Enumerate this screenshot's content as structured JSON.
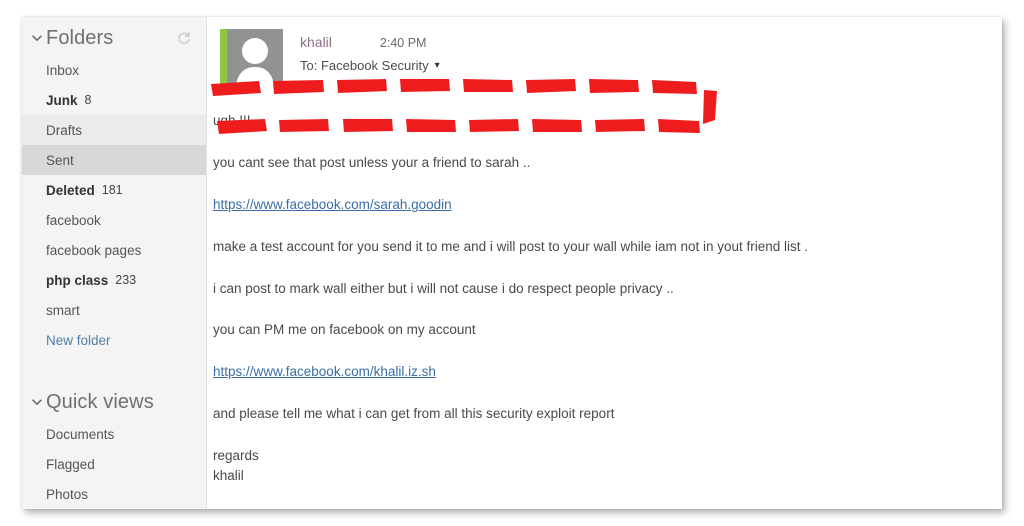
{
  "sidebar": {
    "folders_section": {
      "title": "Folders",
      "chevron_icon": "chevron-down-icon",
      "refresh_icon": "refresh-icon"
    },
    "folders": [
      {
        "label": "Inbox",
        "count": "",
        "style": "normal",
        "state": ""
      },
      {
        "label": "Junk",
        "count": "8",
        "style": "bold",
        "state": ""
      },
      {
        "label": "Drafts",
        "count": "",
        "style": "normal",
        "state": "hover"
      },
      {
        "label": "Sent",
        "count": "",
        "style": "normal",
        "state": "selected"
      },
      {
        "label": "Deleted",
        "count": "181",
        "style": "bold",
        "state": ""
      },
      {
        "label": "facebook",
        "count": "",
        "style": "normal",
        "state": ""
      },
      {
        "label": "facebook pages",
        "count": "",
        "style": "normal",
        "state": ""
      },
      {
        "label": "php class",
        "count": "233",
        "style": "bold",
        "state": ""
      },
      {
        "label": "smart",
        "count": "",
        "style": "normal",
        "state": ""
      },
      {
        "label": "New folder",
        "count": "",
        "style": "link",
        "state": ""
      }
    ],
    "quickviews_section": {
      "title": "Quick views",
      "chevron_icon": "chevron-down-icon"
    },
    "quickviews": [
      {
        "label": "Documents"
      },
      {
        "label": "Flagged"
      },
      {
        "label": "Photos"
      }
    ]
  },
  "message": {
    "avatar_icon": "person-avatar-icon",
    "sender": "khalil",
    "time": "2:40 PM",
    "recipient": "To: Facebook Security",
    "recipient_chevron_icon": "chevron-down-icon",
    "body": {
      "line_1": "ugh !!!",
      "line_2": "you cant see that post unless your a friend to sarah ..",
      "link_1": "https://www.facebook.com/sarah.goodin",
      "line_3": "make a test account for you send it to me and i will post to your wall while iam not in yout friend list .",
      "line_4_highlighted": "i can post to mark wall either but i will not cause i do respect people privacy ..",
      "line_5": "you can PM me on facebook on my account",
      "link_2": "https://www.facebook.com/khalil.iz.sh",
      "line_6": "and please tell me what i can get from all this security exploit report",
      "line_7": "regards",
      "line_8": "khalil"
    }
  },
  "annotation": {
    "type": "hand-drawn-dashed-rectangle",
    "color": "#ee1c1c",
    "target": "i can post to mark wall either but i will not cause i do respect people privacy .."
  },
  "colors": {
    "accent_green": "#8dc63f",
    "annotation_red": "#ee1c1c",
    "link_blue": "#3a6ea5",
    "sender_purple": "#8a6f8a",
    "sidebar_bg": "#f4f4f4",
    "selected_bg": "#d8d8d8"
  }
}
